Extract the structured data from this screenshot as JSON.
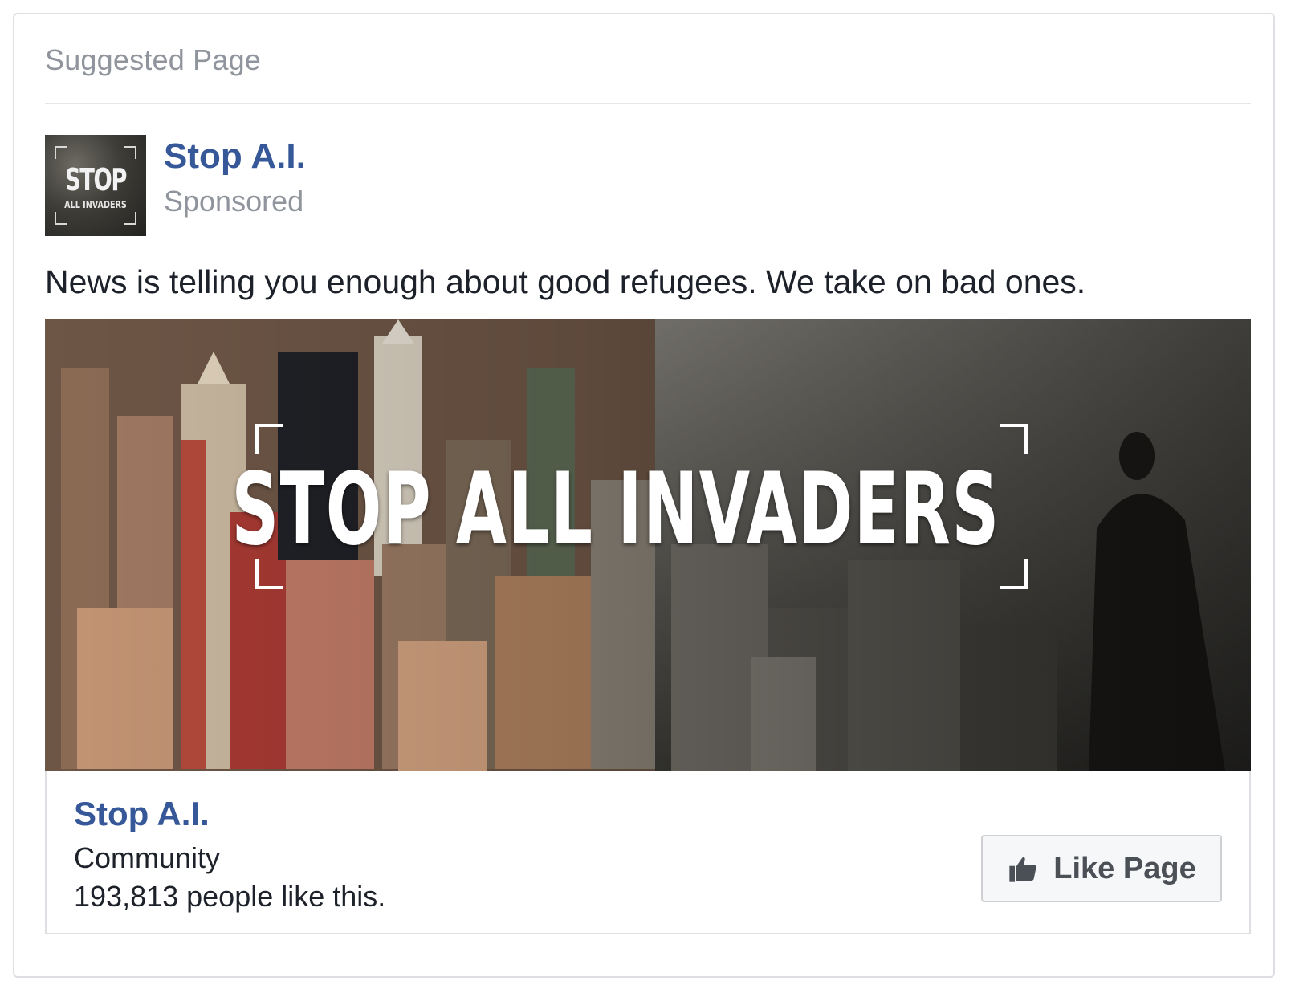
{
  "header": {
    "label": "Suggested Page"
  },
  "page": {
    "name": "Stop A.I.",
    "sponsored_label": "Sponsored",
    "avatar_text": "STOP",
    "avatar_subtext": "ALL INVADERS"
  },
  "post": {
    "text": "News is telling you enough about good refugees. We take on bad ones.",
    "banner_title": "STOP ALL INVADERS"
  },
  "footer": {
    "name": "Stop A.I.",
    "category": "Community",
    "likes": "193,813 people like this.",
    "like_button": "Like Page",
    "like_icon": "thumbs-up-icon"
  },
  "colors": {
    "link_blue": "#365899",
    "muted_gray": "#90949c",
    "text_dark": "#1d2129"
  }
}
